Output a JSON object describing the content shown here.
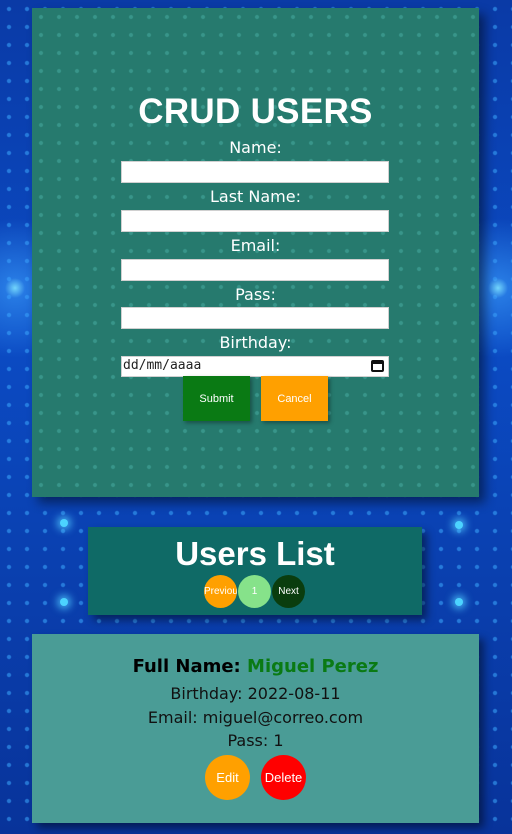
{
  "form": {
    "title": "CRUD USERS",
    "name_label": "Name:",
    "name_value": "",
    "last_name_label": "Last Name:",
    "last_name_value": "",
    "email_label": "Email:",
    "email_value": "",
    "pass_label": "Pass:",
    "pass_value": "",
    "birthday_label": "Birthday:",
    "birthday_placeholder": "dd/mm/aaaa",
    "submit_label": "Submit",
    "cancel_label": "Cancel"
  },
  "list": {
    "title": "Users List",
    "prev_label": "Previous",
    "page_number": "1",
    "next_label": "Next"
  },
  "users": [
    {
      "full_name_label": "Full Name:",
      "full_name": "Miguel Perez",
      "birthday": "Birthday: 2022-08-11",
      "email": "Email: miguel@correo.com",
      "pass": "Pass: 1",
      "edit_label": "Edit",
      "delete_label": "Delete"
    }
  ],
  "colors": {
    "background": "#0b4bc4",
    "form_card": "#267a6e",
    "list_card": "#0f6a66",
    "user_card": "#4a9c96",
    "submit": "#0a7a14",
    "cancel": "#ffa000",
    "edit": "#ffa000",
    "delete": "#ff0000",
    "page_current": "#86e28a",
    "page_next": "#0a3d0e",
    "name_highlight": "#0a7a14"
  },
  "icons": {
    "calendar": "calendar-icon"
  }
}
